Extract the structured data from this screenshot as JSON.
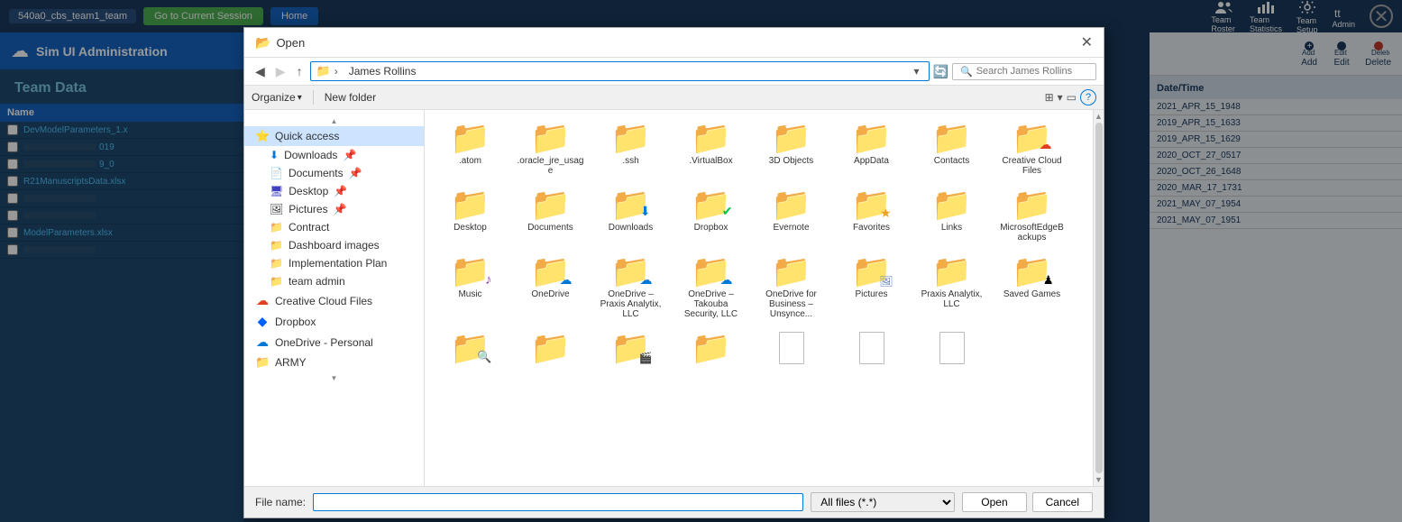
{
  "app": {
    "team_label": "540a0_cbs_team1_team",
    "session_btn": "Go to Current Session",
    "home_btn": "Home",
    "close_x": "✕"
  },
  "top_bar": {
    "team": "Team\nRoster",
    "statistics": "Team\nStatistics",
    "setup": "Team\nSetup",
    "admin": "Admin"
  },
  "sidebar": {
    "app_title": "Sim UI Administration",
    "section_title": "Team Data",
    "table_header": "Name",
    "rows": [
      {
        "filename": "DevModelParameters_1.x",
        "value": "",
        "blurred": false
      },
      {
        "filename": "",
        "value": "019",
        "blurred": true
      },
      {
        "filename": "",
        "value": "9_0",
        "blurred": true
      },
      {
        "filename": "R21ManuscriptsData.xlsx",
        "value": "",
        "blurred": false
      },
      {
        "filename": "",
        "value": "",
        "blurred": true
      },
      {
        "filename": "",
        "value": "",
        "blurred": true
      },
      {
        "filename": "ModelParameters.xlsx",
        "value": "",
        "blurred": false
      },
      {
        "filename": "",
        "value": "",
        "blurred": true
      }
    ]
  },
  "right_panel": {
    "add_btn": "Add",
    "edit_btn": "Edit",
    "delete_btn": "Delete",
    "date_header": "Date/Time",
    "dates": [
      "2021_APR_15_1948",
      "2019_APR_15_1633",
      "2019_APR_15_1629",
      "2020_OCT_27_0517",
      "2020_OCT_26_1648",
      "2020_MAR_17_1731",
      "2021_MAY_07_1954",
      "2021_MAY_07_1951"
    ]
  },
  "dialog": {
    "title": "Open",
    "address_path": "James Rollins",
    "search_placeholder": "Search James Rollins",
    "organize_label": "Organize",
    "new_folder_label": "New folder",
    "nav_items": [
      {
        "label": "Quick access",
        "icon": "⭐",
        "type": "header",
        "selected": true
      },
      {
        "label": "Downloads",
        "icon": "⬇",
        "type": "sub",
        "pinned": true
      },
      {
        "label": "Documents",
        "icon": "📄",
        "type": "sub",
        "pinned": true
      },
      {
        "label": "Desktop",
        "icon": "🖥",
        "type": "sub",
        "pinned": true
      },
      {
        "label": "Pictures",
        "icon": "🖼",
        "type": "sub",
        "pinned": true
      },
      {
        "label": "Contract",
        "icon": "📁",
        "type": "sub",
        "pinned": false
      },
      {
        "label": "Dashboard images",
        "icon": "📁",
        "type": "sub",
        "pinned": false
      },
      {
        "label": "Implementation Plan",
        "icon": "📁",
        "type": "sub",
        "pinned": false
      },
      {
        "label": "team admin",
        "icon": "📁",
        "type": "sub",
        "pinned": false
      },
      {
        "label": "Creative Cloud Files",
        "icon": "☁",
        "type": "item",
        "pinned": false
      },
      {
        "label": "Dropbox",
        "icon": "📦",
        "type": "item",
        "pinned": false
      },
      {
        "label": "OneDrive - Personal",
        "icon": "☁",
        "type": "item",
        "pinned": false
      },
      {
        "label": "ARMY",
        "icon": "📁",
        "type": "item",
        "pinned": false
      }
    ],
    "files": [
      {
        "name": ".atom",
        "icon": "📁",
        "color": "#f0c040"
      },
      {
        "name": ".oracle_jre_usage",
        "icon": "📁",
        "color": "#f0c040"
      },
      {
        "name": ".ssh",
        "icon": "📁",
        "color": "#f0c040"
      },
      {
        "name": ".VirtualBox",
        "icon": "📁",
        "color": "#f0c040"
      },
      {
        "name": "3D Objects",
        "icon": "📁",
        "color": "#f0c040"
      },
      {
        "name": "AppData",
        "icon": "📁",
        "color": "#f0c040"
      },
      {
        "name": "Contacts",
        "icon": "📁",
        "color": "#f0c040"
      },
      {
        "name": "Creative Cloud Files",
        "icon": "📁",
        "color": "#f0c040",
        "special": "cc"
      },
      {
        "name": "Desktop",
        "icon": "📁",
        "color": "#f0c040"
      },
      {
        "name": "Documents",
        "icon": "📁",
        "color": "#f0c040"
      },
      {
        "name": "Downloads",
        "icon": "📁",
        "color": "#f0c040"
      },
      {
        "name": "Dropbox",
        "icon": "📁",
        "color": "#f0c040",
        "special": "dropbox"
      },
      {
        "name": "Evernote",
        "icon": "📁",
        "color": "#f0c040"
      },
      {
        "name": "Favorites",
        "icon": "📁",
        "color": "#f0c040"
      },
      {
        "name": "Links",
        "icon": "📁",
        "color": "#f0c040"
      },
      {
        "name": "MicrosoftEdgeBackups",
        "icon": "📁",
        "color": "#f0c040"
      },
      {
        "name": "Music",
        "icon": "📁",
        "color": "#f0c040",
        "special": "music"
      },
      {
        "name": "OneDrive",
        "icon": "📁",
        "color": "#f0c040",
        "special": "onedrive"
      },
      {
        "name": "OneDrive - Praxis Analytix, LLC",
        "icon": "📁",
        "color": "#f0c040",
        "special": "onedrive"
      },
      {
        "name": "OneDrive - Takouba Security, LLC",
        "icon": "📁",
        "color": "#f0c040",
        "special": "onedrive"
      },
      {
        "name": "OneDrive for Business – Unsynce...",
        "icon": "📁",
        "color": "#f0c040"
      },
      {
        "name": "Pictures",
        "icon": "📁",
        "color": "#f0c040",
        "special": "pictures"
      },
      {
        "name": "Praxis Analytix, LLC",
        "icon": "📁",
        "color": "#f0c040"
      },
      {
        "name": "Saved Games",
        "icon": "📁",
        "color": "#f0c040",
        "special": "chess"
      }
    ],
    "file_name_label": "File name:",
    "file_name_value": "",
    "file_type_label": "All files (*.*)",
    "open_btn": "Open",
    "cancel_btn": "Cancel"
  }
}
